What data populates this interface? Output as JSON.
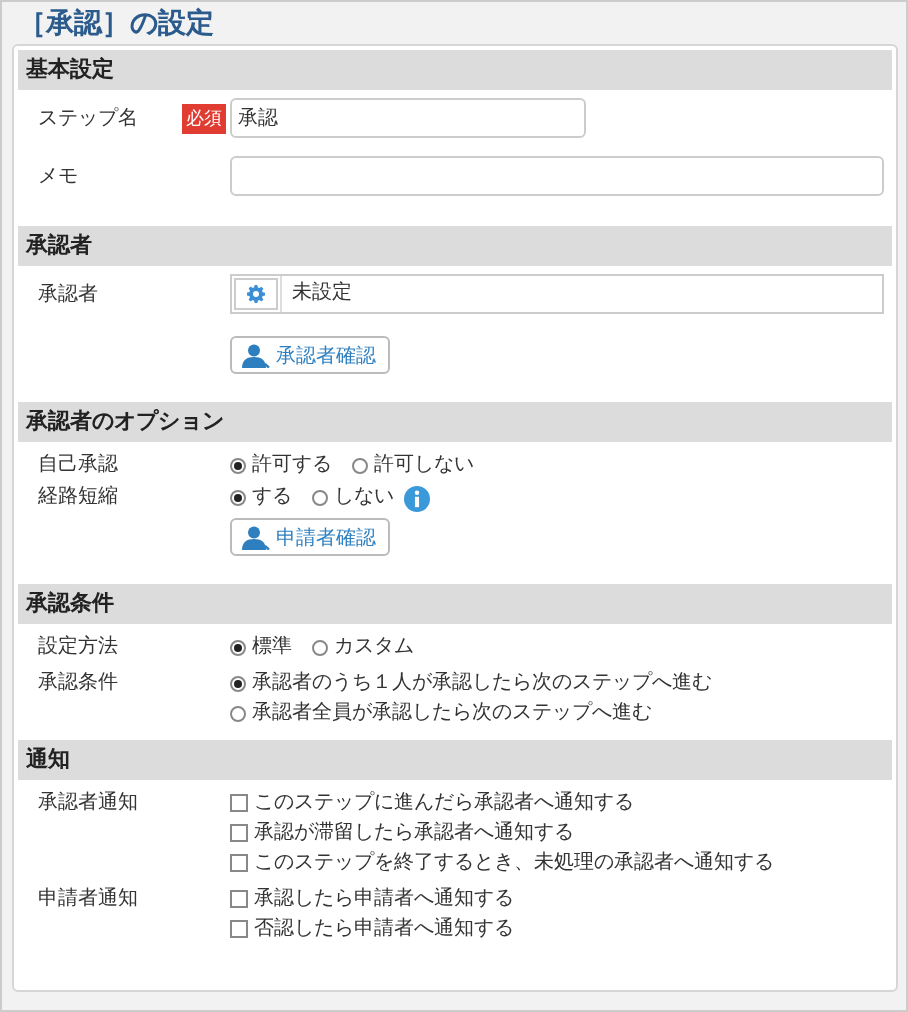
{
  "title": "［承認］の設定",
  "sections": [
    {
      "heading": "基本設定",
      "rows": [
        {
          "kind": "short-text",
          "label": "ステップ名",
          "required": "必須",
          "value": "承認"
        },
        {
          "kind": "text",
          "label": "メモ"
        }
      ]
    },
    {
      "heading": "承認者",
      "rows": [
        {
          "kind": "picker",
          "label": "承認者",
          "value": "未設定"
        },
        {
          "kind": "button",
          "button": "承認者確認"
        }
      ]
    },
    {
      "heading": "承認者のオプション",
      "rows": [
        {
          "kind": "radio",
          "label": "自己承認",
          "options": [
            {
              "label": "許可する",
              "selected": true
            },
            {
              "label": "許可しない",
              "selected": false
            }
          ]
        },
        {
          "kind": "radio",
          "label": "経路短縮",
          "info": true,
          "options": [
            {
              "label": "する",
              "selected": true
            },
            {
              "label": "しない",
              "selected": false
            }
          ]
        },
        {
          "kind": "button",
          "button": "申請者確認"
        }
      ]
    },
    {
      "heading": "承認条件",
      "rows": [
        {
          "kind": "radio",
          "label": "設定方法",
          "options": [
            {
              "label": "標準",
              "selected": true
            },
            {
              "label": "カスタム",
              "selected": false
            }
          ]
        },
        {
          "kind": "radio-list",
          "label": "承認条件",
          "options": [
            {
              "label": "承認者のうち１人が承認したら次のステップへ進む",
              "selected": true
            },
            {
              "label": "承認者全員が承認したら次のステップへ進む",
              "selected": false
            }
          ]
        }
      ]
    },
    {
      "heading": "通知",
      "rows": [
        {
          "kind": "checks",
          "label": "承認者通知",
          "options": [
            {
              "label": "このステップに進んだら承認者へ通知する",
              "checked": false
            },
            {
              "label": "承認が滞留したら承認者へ通知する",
              "checked": false
            },
            {
              "label": "このステップを終了するとき、未処理の承認者へ通知する",
              "checked": false
            }
          ]
        },
        {
          "kind": "checks",
          "label": "申請者通知",
          "options": [
            {
              "label": "承認したら申請者へ通知する",
              "checked": false
            },
            {
              "label": "否認したら申請者へ通知する",
              "checked": false
            }
          ]
        }
      ]
    }
  ]
}
